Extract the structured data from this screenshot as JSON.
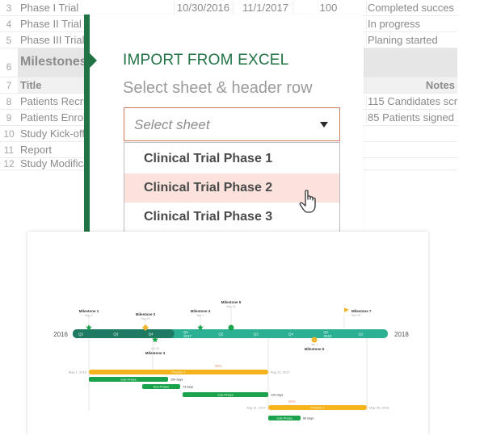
{
  "spreadsheet": {
    "rows": [
      {
        "num": "3",
        "title": "Phase I Trial",
        "start": "10/30/2016",
        "end": "11/1/2017",
        "percent": "100",
        "notes": "Completed succes"
      },
      {
        "num": "4",
        "title": "Phase II Trial",
        "start": "",
        "end": "",
        "percent": "",
        "notes": "In progress"
      },
      {
        "num": "5",
        "title": "Phase III Trial",
        "start": "",
        "end": "",
        "percent": "",
        "notes": "Planing started"
      }
    ],
    "milestone_header": {
      "num": "6",
      "title": "Milestones"
    },
    "column_header": {
      "num": "7",
      "title": "Title",
      "notes": "Notes"
    },
    "milestone_rows": [
      {
        "num": "8",
        "title": "Patients Recruited",
        "notes": "115 Candidates scr"
      },
      {
        "num": "9",
        "title": "Patients Enrolled",
        "notes": "85 Patients signed"
      },
      {
        "num": "10",
        "title": "Study Kick-off",
        "notes": ""
      },
      {
        "num": "11",
        "title": "Report",
        "notes": ""
      },
      {
        "num": "12",
        "title": "Study Modification",
        "notes": ""
      }
    ]
  },
  "import_panel": {
    "title": "IMPORT FROM EXCEL",
    "subtitle": "Select sheet & header row",
    "select": {
      "placeholder": "Select sheet",
      "caret_icon": "triangle-down"
    },
    "options": [
      "Clinical Trial Phase 1",
      "Clinical Trial Phase 2",
      "Clinical Trial Phase 3"
    ],
    "hovered_option": "Clinical Trial Phase 2",
    "accent_color": "#217346",
    "select_border_color": "#d07a62",
    "hover_color": "#fbe2dc"
  },
  "timeline": {
    "start_year": "2016",
    "end_year": "2018",
    "quarters": [
      {
        "label": "Q2",
        "year": ""
      },
      {
        "label": "Q3",
        "year": ""
      },
      {
        "label": "Q4",
        "year": ""
      },
      {
        "label": "Q1",
        "year": "2017"
      },
      {
        "label": "Q2",
        "year": ""
      },
      {
        "label": "Q3",
        "year": ""
      },
      {
        "label": "Q4",
        "year": ""
      },
      {
        "label": "Q1",
        "year": "2018"
      },
      {
        "label": "Q2",
        "year": ""
      }
    ],
    "elapsed_color": "#1f7a63",
    "bar_color": "#2bb093",
    "milestones": [
      {
        "name": "Milestone 1",
        "date": "May 1",
        "shape": "star",
        "color": "#1aa34a",
        "side": "above"
      },
      {
        "name": "Milestone 2",
        "date": "Sep 30",
        "shape": "diamond",
        "color": "#f2b632",
        "side": "above"
      },
      {
        "name": "Milestone 3",
        "date": "Oct 30",
        "shape": "star",
        "color": "#1aa34a",
        "side": "below"
      },
      {
        "name": "Milestone 4",
        "date": "Mar 1",
        "shape": "star",
        "color": "#1aa34a",
        "side": "above"
      },
      {
        "name": "Milestone 5",
        "date": "Mar 15",
        "shape": "circle",
        "color": "#1aa34a",
        "side": "above"
      },
      {
        "name": "Milestone 6",
        "date": "Jan 1",
        "shape": "circle",
        "color": "#f2b632",
        "side": "below"
      },
      {
        "name": "Milestone 7",
        "date": "Mar 15",
        "shape": "flag",
        "color": "#f2b632",
        "side": "above"
      }
    ],
    "phases": [
      {
        "name": "PHASE 1",
        "percent": "75%",
        "start": "May 1, 2016",
        "end": "Aug 31, 2017",
        "color": "#f5b31c",
        "subphases": [
          {
            "name": "Sub-Phase",
            "duration": "154 days"
          },
          {
            "name": "Sub-Phase",
            "duration": "73 days"
          },
          {
            "name": "Sub-Phase",
            "duration": "129 days"
          }
        ]
      },
      {
        "name": "PHASE 2",
        "percent": "25%",
        "start": "Aug 31, 2017",
        "end": "May 26, 2018",
        "color": "#f5b31c",
        "subphases": [
          {
            "name": "Sub-Phase",
            "duration": "66 days"
          }
        ]
      }
    ],
    "subphase_color": "#1aa34a",
    "percent_color": "#e8896a"
  }
}
